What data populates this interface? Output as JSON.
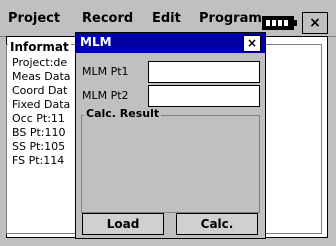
{
  "menubar": {
    "items": [
      "Project",
      "Record",
      "Edit",
      "Program"
    ],
    "close": "×"
  },
  "main": {
    "title": "Informat",
    "lines": [
      "Project:de",
      "Meas Data",
      "Coord Dat",
      "Fixed Data",
      "Occ Pt:11",
      "BS Pt:110",
      "SS Pt:105",
      "FS Pt:114"
    ]
  },
  "dialog": {
    "title": "MLM",
    "close": "×",
    "fields": {
      "pt1_label": "MLM  Pt1",
      "pt1_value": "",
      "pt2_label": "MLM  Pt2",
      "pt2_value": ""
    },
    "result_title": "Calc. Result",
    "buttons": {
      "load": "Load",
      "calc": "Calc."
    }
  }
}
